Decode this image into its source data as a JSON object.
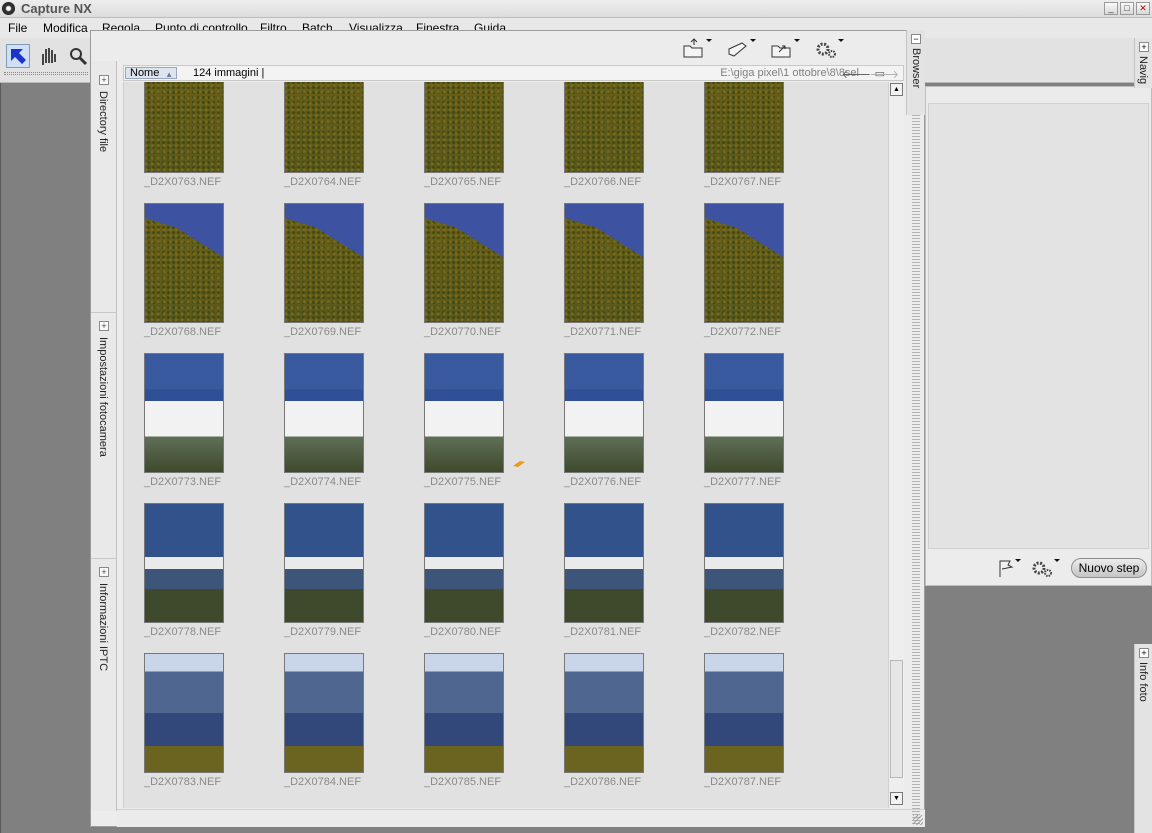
{
  "app": {
    "title": "Capture NX",
    "window_buttons": {
      "minimize": "_",
      "maximize": "□",
      "close": "✕"
    }
  },
  "menu": [
    "File",
    "Modifica",
    "Regola",
    "Punto di controllo",
    "Filtro",
    "Batch",
    "Visualizza",
    "Finestra",
    "Guida"
  ],
  "tools": {
    "select": "select-arrow-icon",
    "hand": "hand-icon",
    "zoom": "zoom-icon"
  },
  "side_panels": [
    "Directory file",
    "Impostazioni fotocamera",
    "Informazioni IPTC"
  ],
  "browser": {
    "sort_label": "Nome",
    "count": "124 immagini |",
    "path": "E:\\giga pixel\\1 ottobre\\8\\8sel",
    "toolbar_icons": [
      "open-folder-icon",
      "tag-icon",
      "folder-share-icon",
      "batch-gears-icon"
    ],
    "thumbnails": [
      {
        "name": "_D2X0763.NEF",
        "scene": "forest"
      },
      {
        "name": "_D2X0764.NEF",
        "scene": "forest"
      },
      {
        "name": "_D2X0765.NEF",
        "scene": "forest"
      },
      {
        "name": "_D2X0766.NEF",
        "scene": "forest"
      },
      {
        "name": "_D2X0767.NEF",
        "scene": "forest"
      },
      {
        "name": "_D2X0768.NEF",
        "scene": "slope"
      },
      {
        "name": "_D2X0769.NEF",
        "scene": "slope"
      },
      {
        "name": "_D2X0770.NEF",
        "scene": "slope"
      },
      {
        "name": "_D2X0771.NEF",
        "scene": "slope"
      },
      {
        "name": "_D2X0772.NEF",
        "scene": "slope"
      },
      {
        "name": "_D2X0773.NEF",
        "scene": "cloud"
      },
      {
        "name": "_D2X0774.NEF",
        "scene": "cloud"
      },
      {
        "name": "_D2X0775.NEF",
        "scene": "cloud",
        "edited": true
      },
      {
        "name": "_D2X0776.NEF",
        "scene": "cloud"
      },
      {
        "name": "_D2X0777.NEF",
        "scene": "cloud"
      },
      {
        "name": "_D2X0778.NEF",
        "scene": "mist"
      },
      {
        "name": "_D2X0779.NEF",
        "scene": "mist"
      },
      {
        "name": "_D2X0780.NEF",
        "scene": "mist"
      },
      {
        "name": "_D2X0781.NEF",
        "scene": "mist"
      },
      {
        "name": "_D2X0782.NEF",
        "scene": "mist"
      },
      {
        "name": "_D2X0783.NEF",
        "scene": "mountain"
      },
      {
        "name": "_D2X0784.NEF",
        "scene": "mountain"
      },
      {
        "name": "_D2X0785.NEF",
        "scene": "mountain"
      },
      {
        "name": "_D2X0786.NEF",
        "scene": "mountain"
      },
      {
        "name": "_D2X0787.NEF",
        "scene": "mountain"
      }
    ]
  },
  "right": {
    "browser_tab": "Browser",
    "navig_tab": "Navig",
    "info_tab": "Info foto",
    "new_step": "Nuovo step"
  },
  "colors": {
    "accent": "#1a33cc",
    "workspace": "#808080",
    "panel": "#ececec"
  }
}
